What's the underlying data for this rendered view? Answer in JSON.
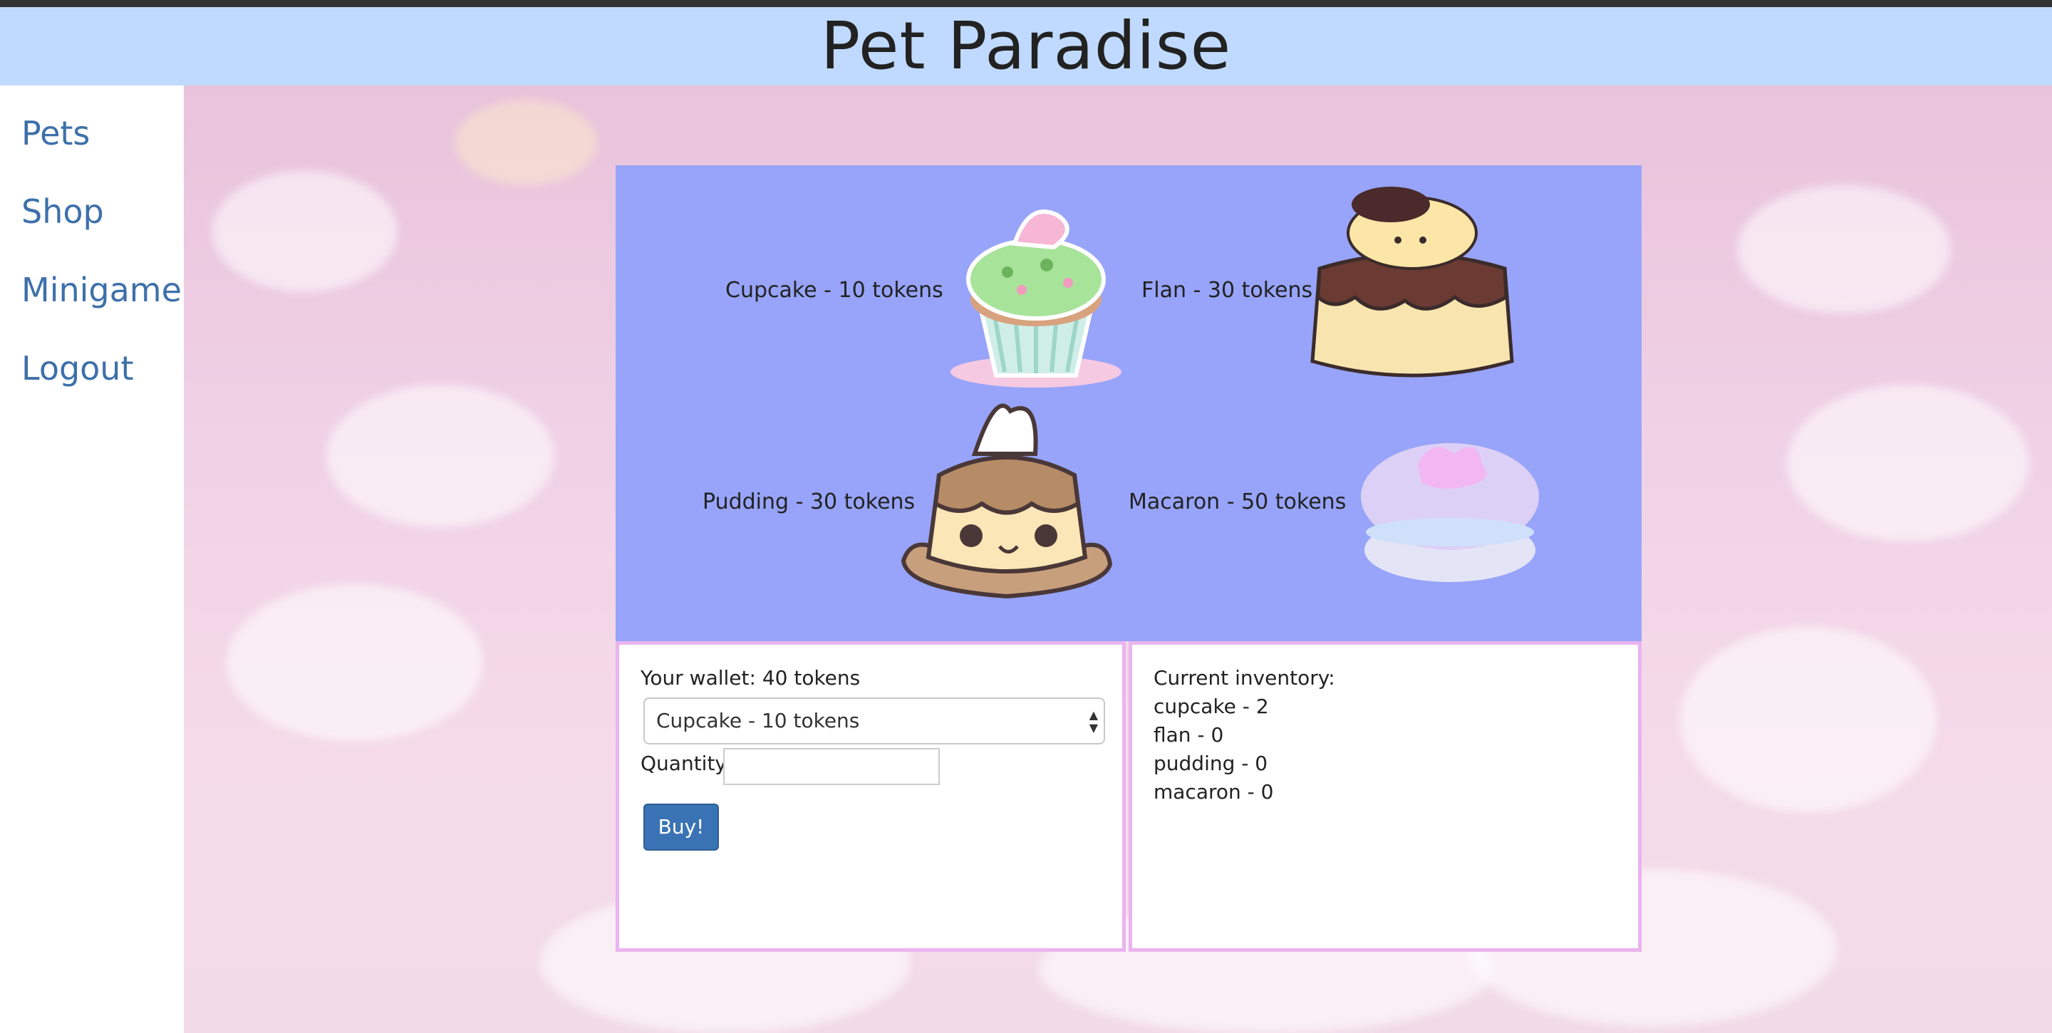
{
  "header": {
    "title": "Pet Paradise"
  },
  "nav": {
    "items": [
      "Pets",
      "Shop",
      "Minigame",
      "Logout"
    ]
  },
  "shop": {
    "items": [
      {
        "label": "Cupcake - 10 tokens",
        "icon": "cupcake-image"
      },
      {
        "label": "Flan - 30 tokens",
        "icon": "flan-image"
      },
      {
        "label": "Pudding - 30 tokens",
        "icon": "pudding-image"
      },
      {
        "label": "Macaron - 50 tokens",
        "icon": "macaron-image"
      }
    ]
  },
  "purchase": {
    "wallet_text": "Your wallet: 40 tokens",
    "selected_item": "Cupcake - 10 tokens",
    "quantity_label": "Quantity:",
    "quantity_value": "",
    "buy_label": "Buy!"
  },
  "inventory": {
    "title": "Current inventory:",
    "lines": [
      "cupcake - 2",
      "flan - 0",
      "pudding - 0",
      "macaron - 0"
    ]
  },
  "colors": {
    "header_bg": "#c0daff",
    "panel_bg": "#97a4f9",
    "box_border": "#eab4ef",
    "link": "#3d70aa",
    "button": "#3a73b3"
  }
}
